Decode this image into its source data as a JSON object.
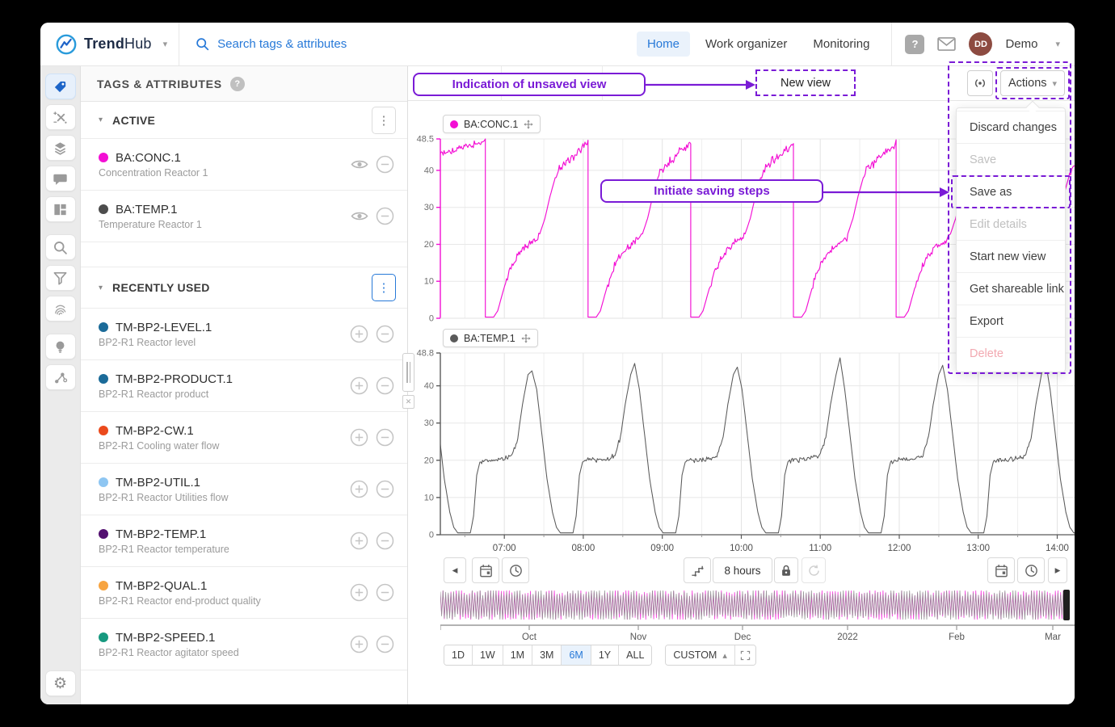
{
  "app": {
    "brand_bold": "Trend",
    "brand_light": "Hub"
  },
  "colors": {
    "accent_blue": "#2779d8",
    "annotation_purple": "#7a1bd6",
    "magenta": "#f30fd4",
    "series_gray": "#5a5a5a"
  },
  "navbar": {
    "search_placeholder": "Search tags & attributes",
    "links": [
      {
        "label": "Home",
        "active": true
      },
      {
        "label": "Work organizer",
        "active": false
      },
      {
        "label": "Monitoring",
        "active": false
      }
    ],
    "user": {
      "initials": "DD",
      "name": "Demo"
    }
  },
  "sidebar": {
    "icons": [
      {
        "name": "tag-icon",
        "active": true
      },
      {
        "name": "formula-icon"
      },
      {
        "name": "layers-icon"
      },
      {
        "name": "comment-icon"
      },
      {
        "name": "dashboard-icon"
      },
      {
        "name": "search-icon",
        "gap": true
      },
      {
        "name": "filter-icon"
      },
      {
        "name": "fingerprint-icon"
      },
      {
        "name": "lightbulb-icon",
        "gap": true
      },
      {
        "name": "graph-icon"
      }
    ],
    "bottom_icon": {
      "name": "settings-icon",
      "glyph": "⚙"
    }
  },
  "tags_panel": {
    "title": "TAGS & ATTRIBUTES",
    "sections": [
      {
        "label": "ACTIVE",
        "menu_active": false,
        "controls": "active",
        "items": [
          {
            "name": "BA:CONC.1",
            "desc": "Concentration Reactor 1",
            "color": "#f30fd4"
          },
          {
            "name": "BA:TEMP.1",
            "desc": "Temperature Reactor 1",
            "color": "#4d4d4d"
          }
        ]
      },
      {
        "label": "RECENTLY USED",
        "menu_active": true,
        "controls": "recent",
        "items": [
          {
            "name": "TM-BP2-LEVEL.1",
            "desc": "BP2-R1 Reactor level",
            "color": "#1b6b99"
          },
          {
            "name": "TM-BP2-PRODUCT.1",
            "desc": "BP2-R1 Reactor product",
            "color": "#1b6b99"
          },
          {
            "name": "TM-BP2-CW.1",
            "desc": "BP2-R1 Cooling water flow",
            "color": "#eb4a1c"
          },
          {
            "name": "TM-BP2-UTIL.1",
            "desc": "BP2-R1 Reactor Utilities flow",
            "color": "#8ec6f2"
          },
          {
            "name": "TM-BP2-TEMP.1",
            "desc": "BP2-R1 Reactor temperature",
            "color": "#531070"
          },
          {
            "name": "TM-BP2-QUAL.1",
            "desc": "BP2-R1 Reactor end-product quality",
            "color": "#f7a440"
          },
          {
            "name": "TM-BP2-SPEED.1",
            "desc": "BP2-R1 Reactor agitator speed",
            "color": "#17997f"
          }
        ]
      }
    ]
  },
  "view_header": {
    "view_title": "New view",
    "actions_label": "Actions"
  },
  "annotations": {
    "unsaved_view": "Indication of unsaved view",
    "saving_steps": "Initiate saving steps"
  },
  "actions_menu": {
    "items": [
      {
        "label": "Discard changes",
        "state": "normal"
      },
      {
        "label": "Save",
        "state": "disabled"
      },
      {
        "label": "Save as",
        "state": "highlight"
      },
      {
        "label": "Edit details",
        "state": "disabled"
      },
      {
        "label": "Start new view",
        "state": "normal"
      },
      {
        "label": "Get shareable link",
        "state": "normal"
      },
      {
        "label": "Export",
        "state": "normal"
      },
      {
        "label": "Delete",
        "state": "danger"
      }
    ]
  },
  "toolbar": {
    "duration_label": "8 hours"
  },
  "timeline": {
    "month_labels": [
      "Oct",
      "Nov",
      "Dec",
      "2022",
      "Feb",
      "Mar"
    ],
    "presets": [
      {
        "label": "1D"
      },
      {
        "label": "1W"
      },
      {
        "label": "1M"
      },
      {
        "label": "3M"
      },
      {
        "label": "6M",
        "active": true
      },
      {
        "label": "1Y"
      },
      {
        "label": "ALL"
      }
    ],
    "custom_label": "CUSTOM"
  },
  "chart_data": [
    {
      "type": "line",
      "name": "BA:CONC.1",
      "color": "#f30fd4",
      "ylim": [
        0,
        48.5
      ],
      "yticks": [
        0,
        10,
        20,
        30,
        40,
        48.5
      ],
      "x_hours": [
        6.19,
        14.22
      ],
      "xticks": [
        7,
        8,
        9,
        10,
        11,
        12,
        13,
        14
      ],
      "xtick_labels": [
        "07:00",
        "08:00",
        "09:00",
        "10:00",
        "11:00",
        "12:00",
        "13:00",
        "14:00"
      ],
      "pattern": {
        "period_h": 1.3,
        "drop_times_h": [
          6.76,
          8.06,
          9.36,
          10.66,
          11.96,
          13.26
        ],
        "lead_in": [
          [
            6.19,
            44.5
          ],
          [
            6.38,
            45.5
          ],
          [
            6.55,
            46.5
          ],
          [
            6.7,
            47.6
          ],
          [
            6.76,
            48.3
          ]
        ],
        "lead_noise": 0.9,
        "cycle_anchors": [
          [
            0,
            0.3
          ],
          [
            0.08,
            0.3
          ],
          [
            0.12,
            2
          ],
          [
            0.18,
            8
          ],
          [
            0.24,
            13
          ],
          [
            0.3,
            16.5
          ],
          [
            0.36,
            18.5
          ],
          [
            0.44,
            20.5
          ],
          [
            0.52,
            22
          ],
          [
            0.58,
            27
          ],
          [
            0.63,
            33
          ],
          [
            0.68,
            38
          ],
          [
            0.72,
            40.5
          ],
          [
            0.78,
            42
          ],
          [
            0.84,
            43.5
          ],
          [
            0.9,
            45
          ],
          [
            0.96,
            46.5
          ],
          [
            1,
            47.5
          ]
        ],
        "noise_zones": [
          [
            0.16,
            0.54,
            1.1
          ],
          [
            0.7,
            1.0,
            1.3
          ]
        ]
      }
    },
    {
      "type": "line",
      "name": "BA:TEMP.1",
      "color": "#5a5a5a",
      "ylim": [
        0,
        48.8
      ],
      "yticks": [
        0,
        10,
        20,
        30,
        40,
        48.8
      ],
      "x_hours": [
        6.19,
        14.22
      ],
      "xticks": [
        7,
        8,
        9,
        10,
        11,
        12,
        13,
        14
      ],
      "xtick_labels": [
        "07:00",
        "08:00",
        "09:00",
        "10:00",
        "11:00",
        "12:00",
        "13:00",
        "14:00"
      ],
      "pattern": {
        "period_h": 1.3,
        "peak_times_h": [
          6.05,
          7.35,
          8.65,
          9.95,
          11.25,
          12.55,
          13.85
        ],
        "peak_heights": [
          44,
          44,
          46,
          45,
          47.5,
          45.5,
          47
        ],
        "cycle_anchors_dt": [
          [
            -0.78,
            0.5
          ],
          [
            -0.74,
            5
          ],
          [
            -0.7,
            16
          ],
          [
            -0.66,
            19.5
          ],
          [
            -0.58,
            20
          ],
          [
            -0.4,
            20.3
          ],
          [
            -0.26,
            21
          ],
          [
            -0.18,
            26
          ],
          [
            -0.12,
            35
          ],
          [
            -0.05,
            43
          ],
          [
            0,
            null
          ],
          [
            0.06,
            39
          ],
          [
            0.12,
            28
          ],
          [
            0.19,
            15
          ],
          [
            0.26,
            6
          ],
          [
            0.31,
            2
          ],
          [
            0.36,
            0.5
          ],
          [
            0.52,
            0.5
          ]
        ],
        "noise_zones_dt": [
          [
            -0.62,
            -0.2,
            0.7
          ]
        ]
      }
    },
    {
      "type": "line",
      "name": "context-overview",
      "description": "6-month overview of BA:CONC.1 and BA:TEMP.1 repeating batch cycles",
      "tick_labels": [
        "Oct",
        "Nov",
        "Dec",
        "2022",
        "Feb",
        "Mar"
      ],
      "colors": [
        "#8f8f8f",
        "#f30fd4"
      ]
    }
  ]
}
